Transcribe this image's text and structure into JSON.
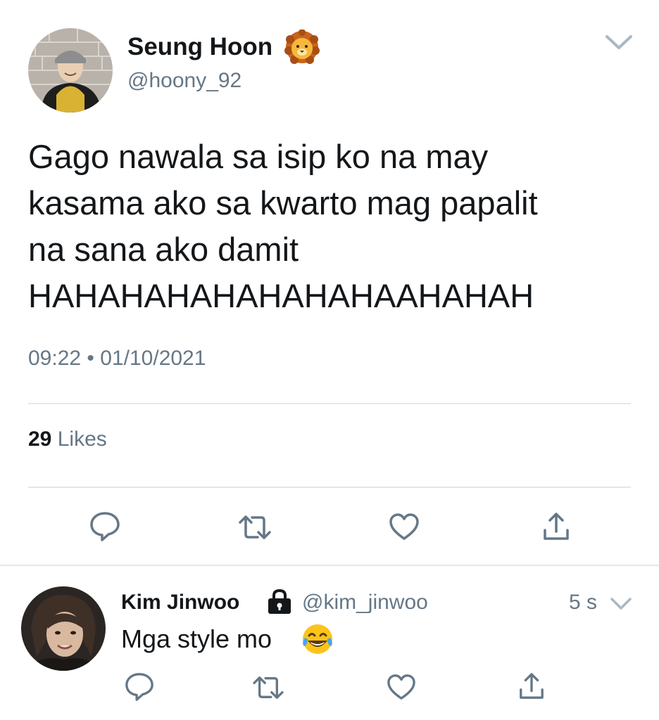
{
  "tweet": {
    "author": {
      "display_name": "Seung Hoon",
      "handle": "@hoony_92",
      "avatar": "user-avatar",
      "badge_icon": "lion-emoji"
    },
    "text": "Gago nawala sa isip ko na may\nkasama ako sa kwarto mag papalit\nna sana ako damit\nHAHAHAHAHAHAHAHAAHAHAH",
    "time": "09:22",
    "separator": "•",
    "date": "01/10/2021",
    "likes_count": "29",
    "likes_label": "Likes",
    "actions": [
      "reply-icon",
      "retweet-icon",
      "like-icon",
      "share-icon"
    ],
    "menu_icon": "chevron-down-icon"
  },
  "reply": {
    "display_name": "Kim Jinwoo",
    "protected_icon": "lock-icon",
    "handle": "@kim_jinwoo",
    "time": "5 s",
    "text": "Mga style mo",
    "text_emoji": "face-with-tears-of-joy-emoji",
    "actions": [
      "reply-icon",
      "retweet-icon",
      "like-icon",
      "share-icon"
    ],
    "menu_icon": "chevron-down-icon"
  },
  "colors": {
    "primary_text": "#14171a",
    "secondary_text": "#657786",
    "icon": "#657786",
    "divider": "#e1e8ed",
    "background": "#ffffff"
  }
}
